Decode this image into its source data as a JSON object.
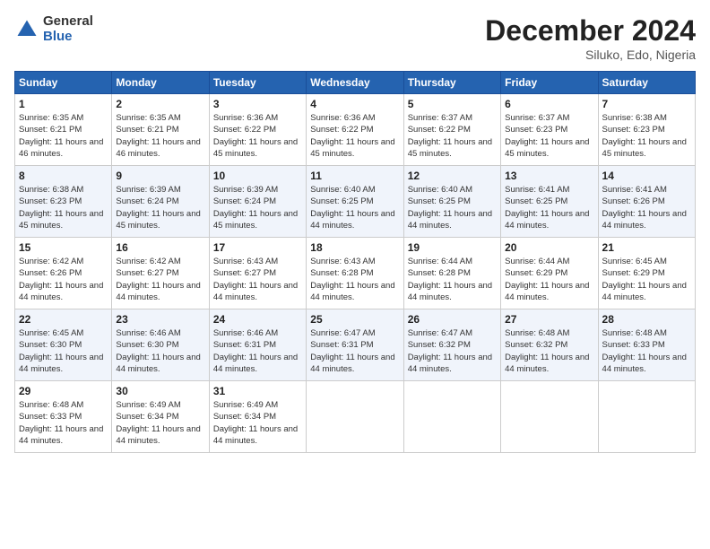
{
  "logo": {
    "general": "General",
    "blue": "Blue"
  },
  "header": {
    "month_year": "December 2024",
    "location": "Siluko, Edo, Nigeria"
  },
  "days_of_week": [
    "Sunday",
    "Monday",
    "Tuesday",
    "Wednesday",
    "Thursday",
    "Friday",
    "Saturday"
  ],
  "weeks": [
    [
      {
        "day": 1,
        "sunrise": "6:35 AM",
        "sunset": "6:21 PM",
        "daylight": "11 hours and 46 minutes."
      },
      {
        "day": 2,
        "sunrise": "6:35 AM",
        "sunset": "6:21 PM",
        "daylight": "11 hours and 46 minutes."
      },
      {
        "day": 3,
        "sunrise": "6:36 AM",
        "sunset": "6:22 PM",
        "daylight": "11 hours and 45 minutes."
      },
      {
        "day": 4,
        "sunrise": "6:36 AM",
        "sunset": "6:22 PM",
        "daylight": "11 hours and 45 minutes."
      },
      {
        "day": 5,
        "sunrise": "6:37 AM",
        "sunset": "6:22 PM",
        "daylight": "11 hours and 45 minutes."
      },
      {
        "day": 6,
        "sunrise": "6:37 AM",
        "sunset": "6:23 PM",
        "daylight": "11 hours and 45 minutes."
      },
      {
        "day": 7,
        "sunrise": "6:38 AM",
        "sunset": "6:23 PM",
        "daylight": "11 hours and 45 minutes."
      }
    ],
    [
      {
        "day": 8,
        "sunrise": "6:38 AM",
        "sunset": "6:23 PM",
        "daylight": "11 hours and 45 minutes."
      },
      {
        "day": 9,
        "sunrise": "6:39 AM",
        "sunset": "6:24 PM",
        "daylight": "11 hours and 45 minutes."
      },
      {
        "day": 10,
        "sunrise": "6:39 AM",
        "sunset": "6:24 PM",
        "daylight": "11 hours and 45 minutes."
      },
      {
        "day": 11,
        "sunrise": "6:40 AM",
        "sunset": "6:25 PM",
        "daylight": "11 hours and 44 minutes."
      },
      {
        "day": 12,
        "sunrise": "6:40 AM",
        "sunset": "6:25 PM",
        "daylight": "11 hours and 44 minutes."
      },
      {
        "day": 13,
        "sunrise": "6:41 AM",
        "sunset": "6:25 PM",
        "daylight": "11 hours and 44 minutes."
      },
      {
        "day": 14,
        "sunrise": "6:41 AM",
        "sunset": "6:26 PM",
        "daylight": "11 hours and 44 minutes."
      }
    ],
    [
      {
        "day": 15,
        "sunrise": "6:42 AM",
        "sunset": "6:26 PM",
        "daylight": "11 hours and 44 minutes."
      },
      {
        "day": 16,
        "sunrise": "6:42 AM",
        "sunset": "6:27 PM",
        "daylight": "11 hours and 44 minutes."
      },
      {
        "day": 17,
        "sunrise": "6:43 AM",
        "sunset": "6:27 PM",
        "daylight": "11 hours and 44 minutes."
      },
      {
        "day": 18,
        "sunrise": "6:43 AM",
        "sunset": "6:28 PM",
        "daylight": "11 hours and 44 minutes."
      },
      {
        "day": 19,
        "sunrise": "6:44 AM",
        "sunset": "6:28 PM",
        "daylight": "11 hours and 44 minutes."
      },
      {
        "day": 20,
        "sunrise": "6:44 AM",
        "sunset": "6:29 PM",
        "daylight": "11 hours and 44 minutes."
      },
      {
        "day": 21,
        "sunrise": "6:45 AM",
        "sunset": "6:29 PM",
        "daylight": "11 hours and 44 minutes."
      }
    ],
    [
      {
        "day": 22,
        "sunrise": "6:45 AM",
        "sunset": "6:30 PM",
        "daylight": "11 hours and 44 minutes."
      },
      {
        "day": 23,
        "sunrise": "6:46 AM",
        "sunset": "6:30 PM",
        "daylight": "11 hours and 44 minutes."
      },
      {
        "day": 24,
        "sunrise": "6:46 AM",
        "sunset": "6:31 PM",
        "daylight": "11 hours and 44 minutes."
      },
      {
        "day": 25,
        "sunrise": "6:47 AM",
        "sunset": "6:31 PM",
        "daylight": "11 hours and 44 minutes."
      },
      {
        "day": 26,
        "sunrise": "6:47 AM",
        "sunset": "6:32 PM",
        "daylight": "11 hours and 44 minutes."
      },
      {
        "day": 27,
        "sunrise": "6:48 AM",
        "sunset": "6:32 PM",
        "daylight": "11 hours and 44 minutes."
      },
      {
        "day": 28,
        "sunrise": "6:48 AM",
        "sunset": "6:33 PM",
        "daylight": "11 hours and 44 minutes."
      }
    ],
    [
      {
        "day": 29,
        "sunrise": "6:48 AM",
        "sunset": "6:33 PM",
        "daylight": "11 hours and 44 minutes."
      },
      {
        "day": 30,
        "sunrise": "6:49 AM",
        "sunset": "6:34 PM",
        "daylight": "11 hours and 44 minutes."
      },
      {
        "day": 31,
        "sunrise": "6:49 AM",
        "sunset": "6:34 PM",
        "daylight": "11 hours and 44 minutes."
      },
      null,
      null,
      null,
      null
    ]
  ]
}
